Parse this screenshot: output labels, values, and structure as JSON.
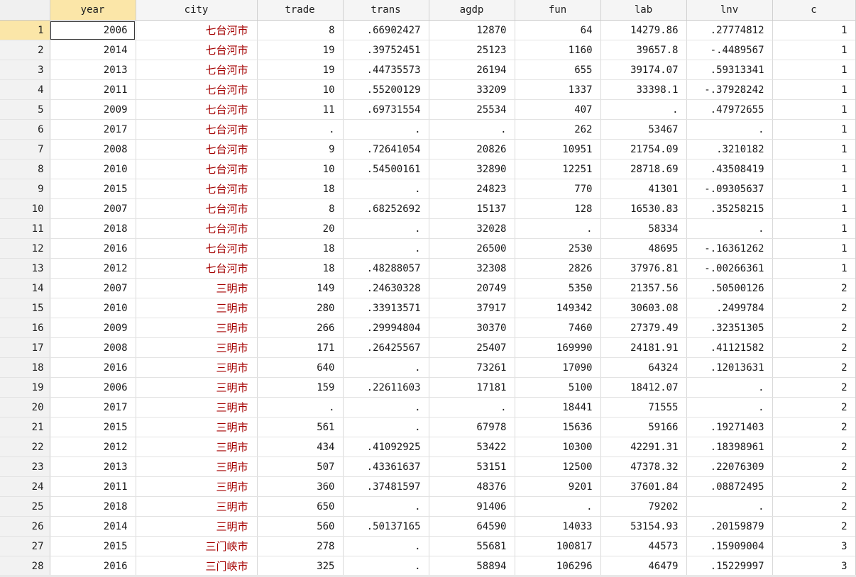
{
  "columns": [
    "year",
    "city",
    "trade",
    "trans",
    "agdp",
    "fun",
    "lab",
    "lnv",
    "c"
  ],
  "selected_column": "year",
  "rows": [
    [
      "1",
      "2006",
      "七台河市",
      "8",
      ".66902427",
      "12870",
      "64",
      "14279.86",
      ".27774812",
      "1"
    ],
    [
      "2",
      "2014",
      "七台河市",
      "19",
      ".39752451",
      "25123",
      "1160",
      "39657.8",
      "-.4489567",
      "1"
    ],
    [
      "3",
      "2013",
      "七台河市",
      "19",
      ".44735573",
      "26194",
      "655",
      "39174.07",
      ".59313341",
      "1"
    ],
    [
      "4",
      "2011",
      "七台河市",
      "10",
      ".55200129",
      "33209",
      "1337",
      "33398.1",
      "-.37928242",
      "1"
    ],
    [
      "5",
      "2009",
      "七台河市",
      "11",
      ".69731554",
      "25534",
      "407",
      ".",
      ".47972655",
      "1"
    ],
    [
      "6",
      "2017",
      "七台河市",
      ".",
      ".",
      ".",
      "262",
      "53467",
      ".",
      "1"
    ],
    [
      "7",
      "2008",
      "七台河市",
      "9",
      ".72641054",
      "20826",
      "10951",
      "21754.09",
      ".3210182",
      "1"
    ],
    [
      "8",
      "2010",
      "七台河市",
      "10",
      ".54500161",
      "32890",
      "12251",
      "28718.69",
      ".43508419",
      "1"
    ],
    [
      "9",
      "2015",
      "七台河市",
      "18",
      ".",
      "24823",
      "770",
      "41301",
      "-.09305637",
      "1"
    ],
    [
      "10",
      "2007",
      "七台河市",
      "8",
      ".68252692",
      "15137",
      "128",
      "16530.83",
      ".35258215",
      "1"
    ],
    [
      "11",
      "2018",
      "七台河市",
      "20",
      ".",
      "32028",
      ".",
      "58334",
      ".",
      "1"
    ],
    [
      "12",
      "2016",
      "七台河市",
      "18",
      ".",
      "26500",
      "2530",
      "48695",
      "-.16361262",
      "1"
    ],
    [
      "13",
      "2012",
      "七台河市",
      "18",
      ".48288057",
      "32308",
      "2826",
      "37976.81",
      "-.00266361",
      "1"
    ],
    [
      "14",
      "2007",
      "三明市",
      "149",
      ".24630328",
      "20749",
      "5350",
      "21357.56",
      ".50500126",
      "2"
    ],
    [
      "15",
      "2010",
      "三明市",
      "280",
      ".33913571",
      "37917",
      "149342",
      "30603.08",
      ".2499784",
      "2"
    ],
    [
      "16",
      "2009",
      "三明市",
      "266",
      ".29994804",
      "30370",
      "7460",
      "27379.49",
      ".32351305",
      "2"
    ],
    [
      "17",
      "2008",
      "三明市",
      "171",
      ".26425567",
      "25407",
      "169990",
      "24181.91",
      ".41121582",
      "2"
    ],
    [
      "18",
      "2016",
      "三明市",
      "640",
      ".",
      "73261",
      "17090",
      "64324",
      ".12013631",
      "2"
    ],
    [
      "19",
      "2006",
      "三明市",
      "159",
      ".22611603",
      "17181",
      "5100",
      "18412.07",
      ".",
      "2"
    ],
    [
      "20",
      "2017",
      "三明市",
      ".",
      ".",
      ".",
      "18441",
      "71555",
      ".",
      "2"
    ],
    [
      "21",
      "2015",
      "三明市",
      "561",
      ".",
      "67978",
      "15636",
      "59166",
      ".19271403",
      "2"
    ],
    [
      "22",
      "2012",
      "三明市",
      "434",
      ".41092925",
      "53422",
      "10300",
      "42291.31",
      ".18398961",
      "2"
    ],
    [
      "23",
      "2013",
      "三明市",
      "507",
      ".43361637",
      "53151",
      "12500",
      "47378.32",
      ".22076309",
      "2"
    ],
    [
      "24",
      "2011",
      "三明市",
      "360",
      ".37481597",
      "48376",
      "9201",
      "37601.84",
      ".08872495",
      "2"
    ],
    [
      "25",
      "2018",
      "三明市",
      "650",
      ".",
      "91406",
      ".",
      "79202",
      ".",
      "2"
    ],
    [
      "26",
      "2014",
      "三明市",
      "560",
      ".50137165",
      "64590",
      "14033",
      "53154.93",
      ".20159879",
      "2"
    ],
    [
      "27",
      "2015",
      "三门峡市",
      "278",
      ".",
      "55681",
      "100817",
      "44573",
      ".15909004",
      "3"
    ],
    [
      "28",
      "2016",
      "三门峡市",
      "325",
      ".",
      "58894",
      "106296",
      "46479",
      ".15229997",
      "3"
    ]
  ]
}
